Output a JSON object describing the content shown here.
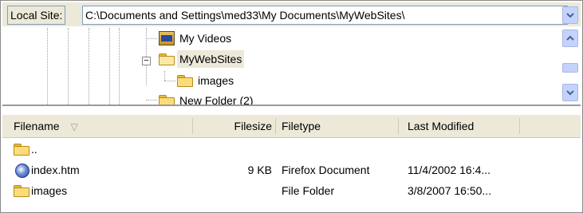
{
  "local_site": {
    "label": "Local Site:",
    "path": "C:\\Documents and Settings\\med33\\My Documents\\MyWebSites\\"
  },
  "tree": {
    "items": [
      {
        "label": "My Videos",
        "icon": "video-folder-icon"
      },
      {
        "label": "MyWebSites",
        "icon": "open-folder-icon",
        "selected": true
      },
      {
        "label": "images",
        "icon": "folder-icon"
      },
      {
        "label": "New Folder (2)",
        "icon": "folder-icon"
      }
    ]
  },
  "list": {
    "columns": [
      "Filename",
      "Filesize",
      "Filetype",
      "Last Modified"
    ],
    "sort_indicator": "▽",
    "rows": [
      {
        "name": "..",
        "size": "",
        "type": "",
        "modified": "",
        "icon": "folder-icon"
      },
      {
        "name": "index.htm",
        "size": "9 KB",
        "type": "Firefox Document",
        "modified": "11/4/2002 16:4...",
        "icon": "html-file-icon"
      },
      {
        "name": "images",
        "size": "",
        "type": "File Folder",
        "modified": "3/8/2007 16:50...",
        "icon": "folder-icon"
      }
    ]
  },
  "colors": {
    "panel": "#ece9d8",
    "scroll_accent": "#c3d3fd",
    "folder": "#fbdc7a"
  }
}
